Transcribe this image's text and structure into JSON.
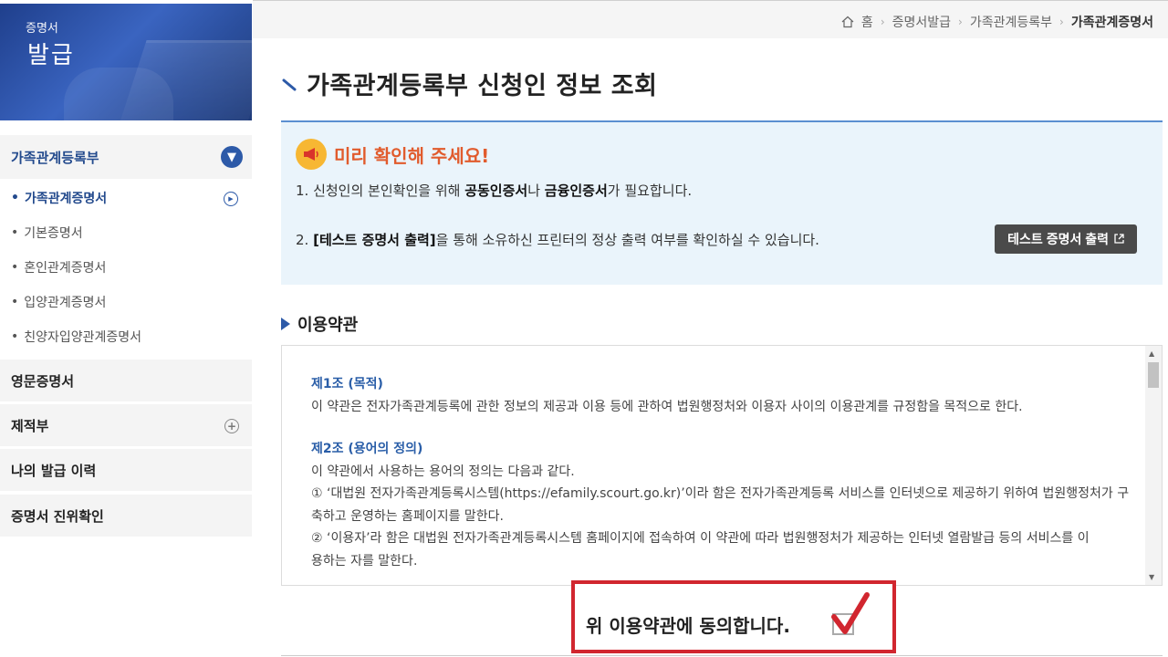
{
  "sidebar": {
    "banner_small": "증명서",
    "banner_big": "발급",
    "section_title": "가족관계등록부",
    "sub_items": [
      {
        "label": "가족관계증명서",
        "active": true
      },
      {
        "label": "기본증명서",
        "active": false
      },
      {
        "label": "혼인관계증명서",
        "active": false
      },
      {
        "label": "입양관계증명서",
        "active": false
      },
      {
        "label": "친양자입양관계증명서",
        "active": false
      }
    ],
    "main_items": [
      {
        "label": "영문증명서"
      },
      {
        "label": "제적부"
      },
      {
        "label": "나의 발급 이력"
      },
      {
        "label": "증명서 진위확인"
      }
    ]
  },
  "breadcrumb": {
    "items": [
      "홈",
      "증명서발급",
      "가족관계등록부"
    ],
    "current": "가족관계증명서"
  },
  "page_title": "가족관계등록부 신청인 정보 조회",
  "notice": {
    "title": "미리 확인해 주세요!",
    "line1": {
      "a": "1. 신청인의 본인확인을 위해 ",
      "b1": "공동인증서",
      "c": "나 ",
      "b2": "금융인증서",
      "d": "가 필요합니다."
    },
    "line2": {
      "b": "[테스트 증명서 출력]",
      "rest": "을 통해 소유하신 프린터의 정상 출력 여부를 확인하실 수 있습니다."
    },
    "line2_prefix": "2. ",
    "test_button": "테스트 증명서 출력"
  },
  "terms": {
    "title": "이용약관",
    "art1_title": "제1조 (목적)",
    "art1_body": "이 약관은 전자가족관계등록에 관한 정보의 제공과 이용 등에 관하여 법원행정처와 이용자 사이의 이용관계를 규정함을 목적으로 한다.",
    "art2_title": "제2조 (용어의 정의)",
    "art2_intro": "이 약관에서 사용하는 용어의 정의는 다음과 같다.",
    "art2_item1a": "① ‘대법원 전자가족관계등록시스템(https://efamily.scourt.go.kr)’이라 함은 전자가족관계등록 서비스를 인터넷으로 제공하기 위하여 법원행정처가 구",
    "art2_item1b": "축하고 운영하는 홈페이지를 말한다.",
    "art2_item2a": "② ‘이용자’라 함은 대법원 전자가족관계등록시스템 홈페이지에 접속하여 이 약관에 따라 법원행정처가 제공하는 인터넷 열람발급 등의 서비스를 이",
    "art2_item2b": "용하는 자를 말한다."
  },
  "agree": {
    "label": "위 이용약관에 동의합니다.",
    "checked": true
  },
  "colors": {
    "accent": "#2d5aa8",
    "notice_bg": "#eaf4fb",
    "notice_title": "#e15b2d",
    "highlight_border": "#d1262f"
  }
}
